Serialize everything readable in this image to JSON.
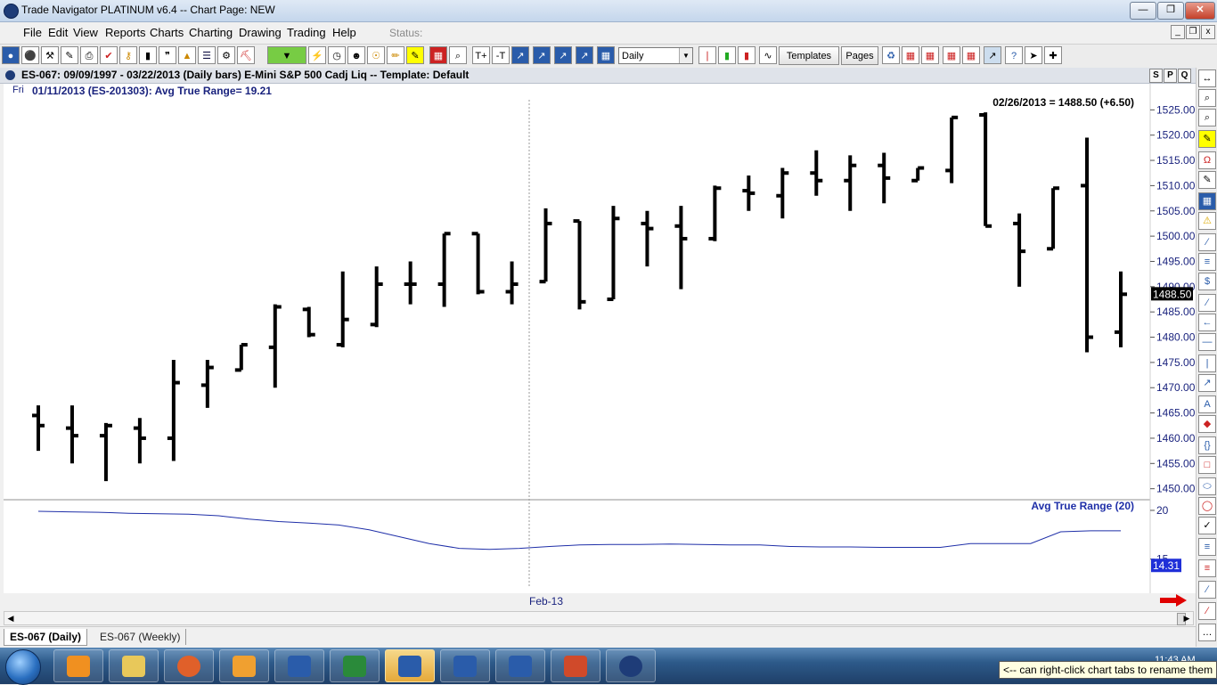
{
  "window": {
    "title": "Trade Navigator PLATINUM v6.4  --  Chart Page: NEW"
  },
  "menu": {
    "items": [
      "File",
      "Edit",
      "View",
      "Reports",
      "Charts",
      "Charting",
      "Drawing",
      "Trading",
      "Help"
    ],
    "status_label": "Status:"
  },
  "toolbar": {
    "period_value": "Daily",
    "templates_label": "Templates",
    "pages_label": "Pages"
  },
  "chart": {
    "header": "ES-067:  09/09/1997 - 03/22/2013  (Daily bars)   E-Mini S&P 500 Cadj Liq  --  Template: Default",
    "info_day": "Fri",
    "info": "01/11/2013 (ES-201303):  Avg True Range= 19.21",
    "price_readout": "02/26/2013 = 1488.50 (+6.50)",
    "last_price_tag": "1488.50",
    "atr_label": "Avg True Range (20)",
    "atr_tag": "14.31",
    "x_label": "Feb-13",
    "spq": [
      "S",
      "P",
      "Q"
    ]
  },
  "chart_data": {
    "type": "ohlc",
    "price_axis": {
      "ticks": [
        "1525.00",
        "1520.00",
        "1515.00",
        "1510.00",
        "1505.00",
        "1500.00",
        "1495.00",
        "1490.00",
        "1485.00",
        "1480.00",
        "1475.00",
        "1470.00",
        "1465.00",
        "1460.00",
        "1455.00",
        "1450.00"
      ],
      "ylim": [
        1448,
        1527
      ]
    },
    "bars": [
      {
        "o": 1464.5,
        "h": 1466.5,
        "l": 1457.5,
        "c": 1462.5
      },
      {
        "o": 1462,
        "h": 1466.5,
        "l": 1455,
        "c": 1460.5
      },
      {
        "o": 1460.5,
        "h": 1463,
        "l": 1451.5,
        "c": 1462.5
      },
      {
        "o": 1462,
        "h": 1464,
        "l": 1455,
        "c": 1460
      },
      {
        "o": 1460,
        "h": 1475.5,
        "l": 1455.5,
        "c": 1471
      },
      {
        "o": 1470.5,
        "h": 1475.5,
        "l": 1466,
        "c": 1474
      },
      {
        "o": 1473.5,
        "h": 1478.5,
        "l": 1473.5,
        "c": 1478.5
      },
      {
        "o": 1478,
        "h": 1486.5,
        "l": 1470,
        "c": 1486
      },
      {
        "o": 1485.5,
        "h": 1486,
        "l": 1480,
        "c": 1480.5
      },
      {
        "o": 1478.5,
        "h": 1493,
        "l": 1478,
        "c": 1483.5
      },
      {
        "o": 1482.5,
        "h": 1494,
        "l": 1482,
        "c": 1490.5
      },
      {
        "o": 1490.5,
        "h": 1495,
        "l": 1486.5,
        "c": 1490.5
      },
      {
        "o": 1490.5,
        "h": 1500.5,
        "l": 1486,
        "c": 1500.5
      },
      {
        "o": 1500.5,
        "h": 1500.5,
        "l": 1488.5,
        "c": 1489
      },
      {
        "o": 1489,
        "h": 1495,
        "l": 1486.5,
        "c": 1490.5
      },
      {
        "o": 1491,
        "h": 1505.5,
        "l": 1491,
        "c": 1502.5
      },
      {
        "o": 1503,
        "h": 1503,
        "l": 1485.5,
        "c": 1487
      },
      {
        "o": 1487.5,
        "h": 1506,
        "l": 1487.5,
        "c": 1503.5
      },
      {
        "o": 1502.5,
        "h": 1505,
        "l": 1494,
        "c": 1501.5
      },
      {
        "o": 1502,
        "h": 1506,
        "l": 1489.5,
        "c": 1499.5
      },
      {
        "o": 1499.5,
        "h": 1510,
        "l": 1499,
        "c": 1509.5
      },
      {
        "o": 1509,
        "h": 1512,
        "l": 1505,
        "c": 1508.5
      },
      {
        "o": 1508,
        "h": 1513.5,
        "l": 1503.5,
        "c": 1512.5
      },
      {
        "o": 1512.5,
        "h": 1517,
        "l": 1508,
        "c": 1511
      },
      {
        "o": 1511,
        "h": 1516,
        "l": 1505,
        "c": 1514
      },
      {
        "o": 1514,
        "h": 1516.5,
        "l": 1506.5,
        "c": 1511.5
      },
      {
        "o": 1511,
        "h": 1513.5,
        "l": 1511,
        "c": 1513.5
      },
      {
        "o": 1513,
        "h": 1523.5,
        "l": 1510.5,
        "c": 1523.5
      },
      {
        "o": 1524,
        "h": 1524.5,
        "l": 1502,
        "c": 1502
      },
      {
        "o": 1502.5,
        "h": 1504.5,
        "l": 1490,
        "c": 1497
      },
      {
        "o": 1497.5,
        "h": 1509.5,
        "l": 1497.5,
        "c": 1509.5
      },
      {
        "o": 1510,
        "h": 1519.5,
        "l": 1477,
        "c": 1480
      },
      {
        "o": 1481,
        "h": 1493,
        "l": 1478,
        "c": 1488.5
      }
    ],
    "atr_axis": {
      "ticks": [
        "20",
        "15"
      ],
      "ylim": [
        11.5,
        21
      ]
    },
    "atr": [
      19.9,
      19.85,
      19.8,
      19.7,
      19.65,
      19.6,
      19.45,
      19.1,
      18.85,
      18.7,
      18.5,
      18.0,
      17.3,
      16.6,
      16.1,
      16.0,
      16.1,
      16.3,
      16.45,
      16.5,
      16.5,
      16.55,
      16.5,
      16.45,
      16.45,
      16.3,
      16.25,
      16.25,
      16.2,
      16.2,
      16.2,
      16.6,
      16.6,
      16.6,
      17.8,
      17.9,
      17.9
    ],
    "grid": false
  }
}
